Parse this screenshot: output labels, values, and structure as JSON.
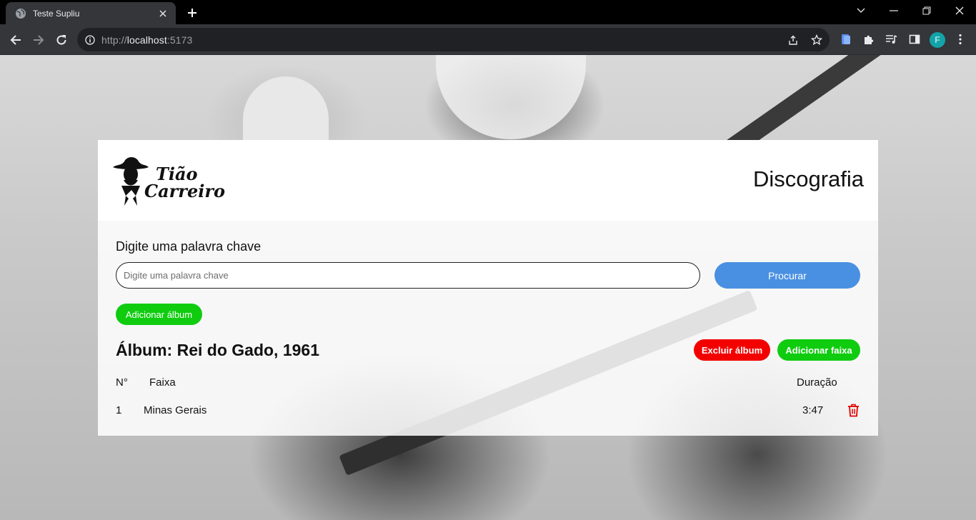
{
  "browser": {
    "tab_title": "Teste Supliu",
    "url_scheme": "http://",
    "url_host": "localhost",
    "url_port": ":5173",
    "profile_initial": "F"
  },
  "header": {
    "logo_alt": "Tião Carreiro",
    "title": "Discografia"
  },
  "search": {
    "label": "Digite uma palavra chave",
    "placeholder": "Digite uma palavra chave",
    "value": "",
    "button_label": "Procurar"
  },
  "actions": {
    "add_album_label": "Adicionar álbum"
  },
  "album": {
    "title": "Álbum: Rei do Gado, 1961",
    "delete_label": "Excluir álbum",
    "add_track_label": "Adicionar faixa",
    "columns": {
      "number": "N°",
      "track": "Faixa",
      "duration": "Duração"
    },
    "tracks": [
      {
        "number": "1",
        "name": "Minas Gerais",
        "duration": "3:47"
      }
    ]
  },
  "colors": {
    "search_button": "#4a90e2",
    "add_button": "#0fcc0f",
    "delete_button": "#f30000",
    "trash_icon": "#e00000"
  }
}
